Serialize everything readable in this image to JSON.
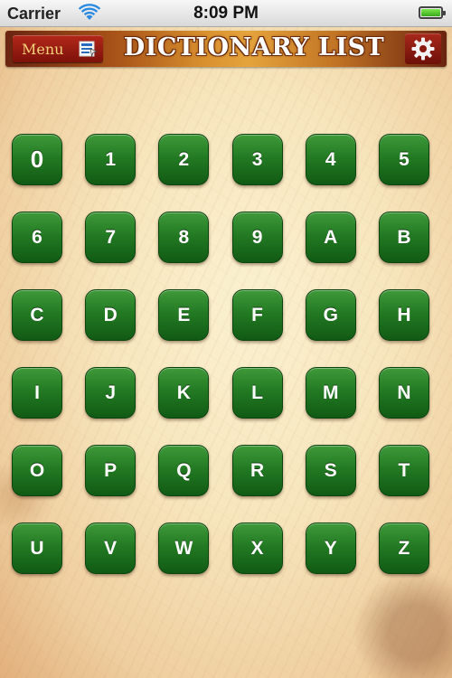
{
  "status_bar": {
    "carrier": "Carrier",
    "time": "8:09 PM",
    "wifi_icon": "wifi-icon",
    "battery_icon": "battery-icon",
    "battery_level": 1.0
  },
  "nav_bar": {
    "menu_label": "Menu",
    "menu_icon": "menu-flag-icon",
    "title": "DICTIONARY LIST",
    "settings_icon": "gear-icon"
  },
  "letters": [
    "0",
    "1",
    "2",
    "3",
    "4",
    "5",
    "6",
    "7",
    "8",
    "9",
    "A",
    "B",
    "C",
    "D",
    "E",
    "F",
    "G",
    "H",
    "I",
    "J",
    "K",
    "L",
    "M",
    "N",
    "O",
    "P",
    "Q",
    "R",
    "S",
    "T",
    "U",
    "V",
    "W",
    "X",
    "Y",
    "Z"
  ],
  "colors": {
    "button_green": "#237a23",
    "nav_orange": "#d8902e",
    "menu_red": "#b3271a",
    "menu_text": "#f2d27a"
  }
}
